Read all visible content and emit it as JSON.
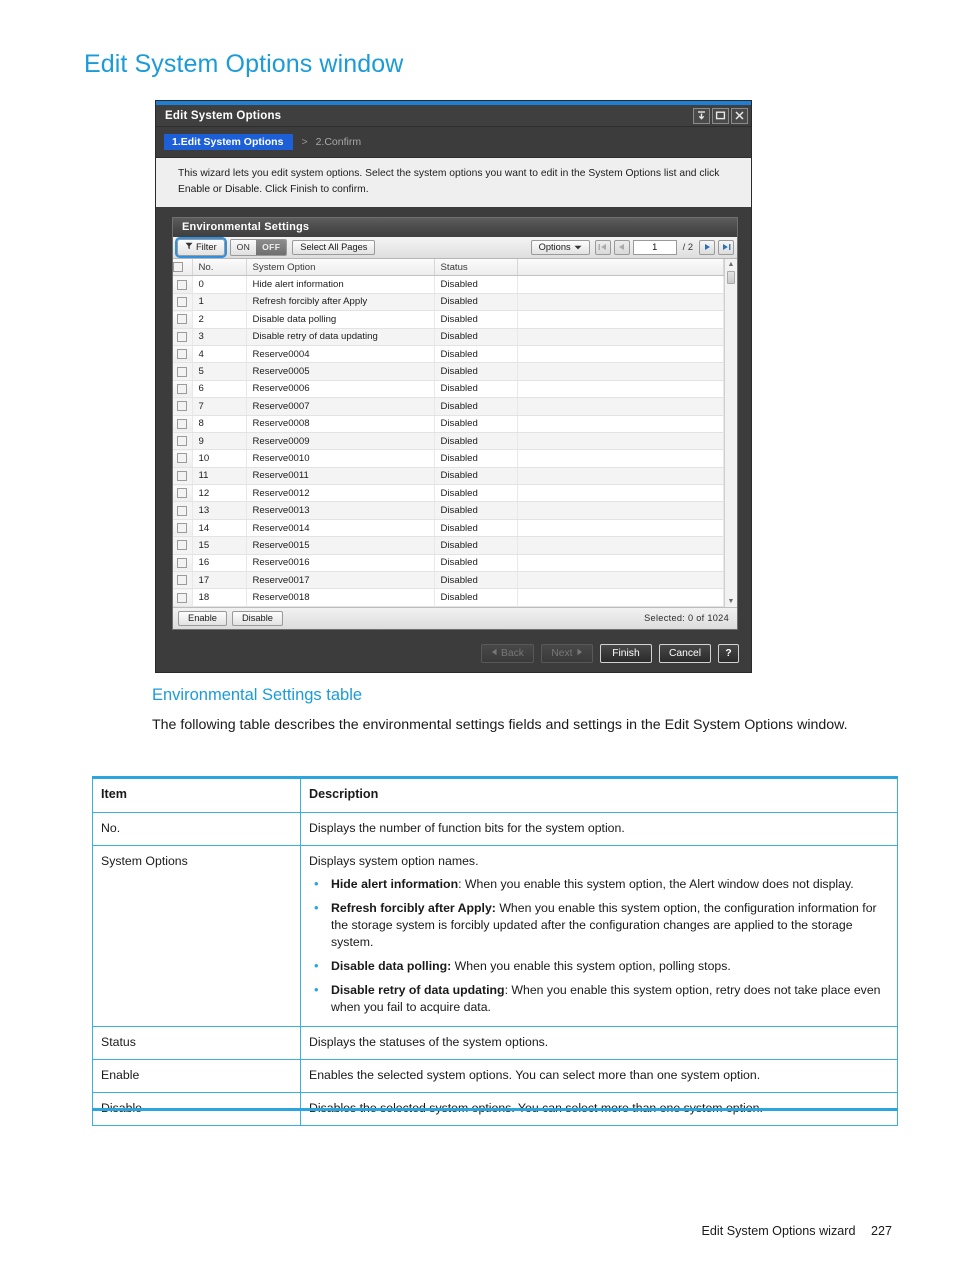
{
  "page": {
    "title": "Edit System Options window",
    "footer_label": "Edit System Options wizard",
    "footer_page": "227",
    "accent_color": "#1b9bd8",
    "table_border_color": "#3bb0e0"
  },
  "wizard": {
    "title": "Edit System Options",
    "window_buttons": [
      "collapse-icon",
      "maximize-icon",
      "close-icon"
    ],
    "steps": {
      "active": "1.Edit System Options",
      "separator": ">",
      "inactive": "2.Confirm"
    },
    "description": "This wizard lets you edit system options. Select the system options you want to edit in the System Options list and click Enable or Disable. Click Finish to confirm.",
    "panel": {
      "header": "Environmental Settings",
      "toolbar": {
        "filter_label": "Filter",
        "on_label": "ON",
        "off_label": "OFF",
        "select_all_pages_label": "Select All Pages",
        "options_label": "Options",
        "page_value": "1",
        "page_total": "/ 2",
        "first_icon": "first-page-icon",
        "prev_icon": "previous-page-icon",
        "next_icon": "next-page-icon",
        "last_icon": "last-page-icon"
      },
      "columns": [
        "No.",
        "System Option",
        "Status",
        ""
      ],
      "rows": [
        {
          "no": "0",
          "option": "Hide alert information",
          "status": "Disabled"
        },
        {
          "no": "1",
          "option": "Refresh forcibly after Apply",
          "status": "Disabled"
        },
        {
          "no": "2",
          "option": "Disable data polling",
          "status": "Disabled"
        },
        {
          "no": "3",
          "option": "Disable retry of data updating",
          "status": "Disabled"
        },
        {
          "no": "4",
          "option": "Reserve0004",
          "status": "Disabled"
        },
        {
          "no": "5",
          "option": "Reserve0005",
          "status": "Disabled"
        },
        {
          "no": "6",
          "option": "Reserve0006",
          "status": "Disabled"
        },
        {
          "no": "7",
          "option": "Reserve0007",
          "status": "Disabled"
        },
        {
          "no": "8",
          "option": "Reserve0008",
          "status": "Disabled"
        },
        {
          "no": "9",
          "option": "Reserve0009",
          "status": "Disabled"
        },
        {
          "no": "10",
          "option": "Reserve0010",
          "status": "Disabled"
        },
        {
          "no": "11",
          "option": "Reserve0011",
          "status": "Disabled"
        },
        {
          "no": "12",
          "option": "Reserve0012",
          "status": "Disabled"
        },
        {
          "no": "13",
          "option": "Reserve0013",
          "status": "Disabled"
        },
        {
          "no": "14",
          "option": "Reserve0014",
          "status": "Disabled"
        },
        {
          "no": "15",
          "option": "Reserve0015",
          "status": "Disabled"
        },
        {
          "no": "16",
          "option": "Reserve0016",
          "status": "Disabled"
        },
        {
          "no": "17",
          "option": "Reserve0017",
          "status": "Disabled"
        },
        {
          "no": "18",
          "option": "Reserve0018",
          "status": "Disabled"
        }
      ],
      "footer": {
        "enable_label": "Enable",
        "disable_label": "Disable",
        "selected_info": "Selected:  0    of  1024"
      }
    },
    "footer_buttons": {
      "back": "Back",
      "next": "Next",
      "finish": "Finish",
      "cancel": "Cancel",
      "help": "?"
    }
  },
  "section": {
    "heading": "Environmental Settings table",
    "paragraph": "The following table describes the environmental settings fields and settings in the Edit System Options window."
  },
  "doc_table": {
    "headers": [
      "Item",
      "Description"
    ],
    "rows": [
      {
        "item": "No.",
        "desc": "Displays the number of function bits for the system option.",
        "bullets": []
      },
      {
        "item": "System Options",
        "desc": "Displays system option names.",
        "bullets": [
          {
            "term": "Hide alert information",
            "sep": ":",
            "text": " When you enable this system option, the Alert window does not display."
          },
          {
            "term": "Refresh forcibly after Apply:",
            "sep": "",
            "text": " When you enable this system option, the configuration information for the storage system is forcibly updated after the configuration changes are applied to the storage system."
          },
          {
            "term": "Disable data polling:",
            "sep": "",
            "text": " When you enable this system option, polling stops."
          },
          {
            "term": "Disable retry of data updating",
            "sep": ":",
            "text": " When you enable this system option, retry does not take place even when you fail to acquire data."
          }
        ]
      },
      {
        "item": "Status",
        "desc": "Displays the statuses of the system options.",
        "bullets": []
      },
      {
        "item": "Enable",
        "desc": "Enables the selected system options. You can select more than one system option.",
        "bullets": []
      },
      {
        "item": "Disable",
        "desc": "Disables the selected system options. You can select more than one system option.",
        "bullets": []
      }
    ]
  }
}
